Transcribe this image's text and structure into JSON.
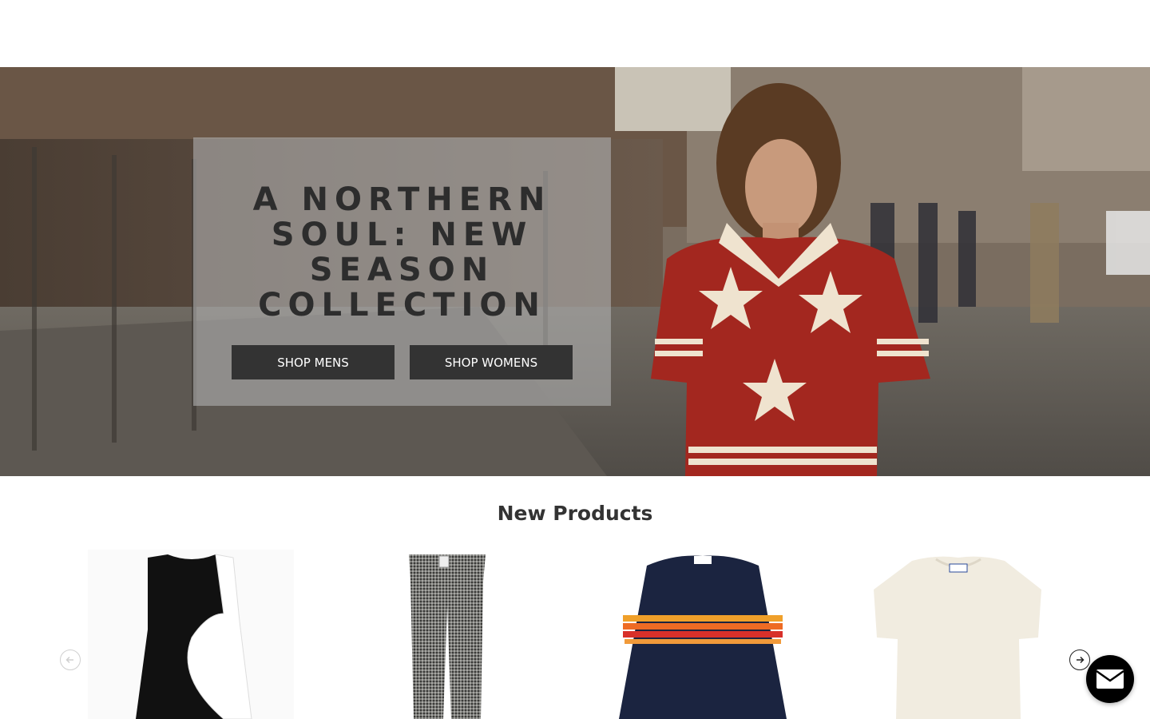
{
  "hero": {
    "title": "A NORTHERN SOUL: NEW SEASON COLLECTION",
    "buttons": {
      "mens": "SHOP MENS",
      "womens": "SHOP WOMENS"
    }
  },
  "new_products": {
    "title": "New Products",
    "items": [
      {
        "image": "black-white-sleeveless-dress"
      },
      {
        "image": "houndstooth-trousers"
      },
      {
        "image": "navy-striped-knit-jumper"
      },
      {
        "image": "cream-knit-tshirt"
      }
    ],
    "prev_icon": "arrow-left-circle-icon",
    "next_icon": "arrow-right-circle-icon"
  },
  "chat": {
    "icon": "envelope-icon"
  },
  "colors": {
    "button_bg": "#333333",
    "button_text": "#ffffff",
    "heading": "#333333"
  }
}
